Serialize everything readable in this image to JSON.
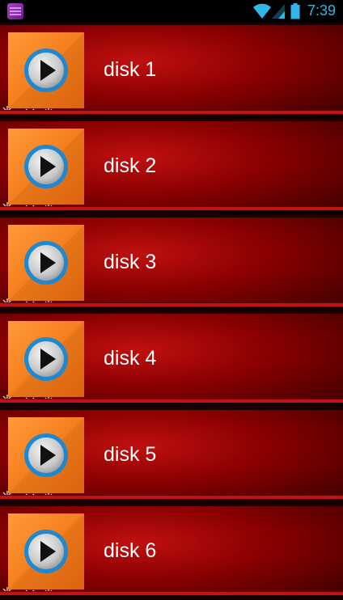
{
  "status_bar": {
    "time": "7:39",
    "icons": [
      "app-icon",
      "wifi-icon",
      "signal-icon",
      "battery-icon"
    ]
  },
  "colors": {
    "status_accent": "#33b5e5",
    "row_red": "#8a0000",
    "thumb_orange": "#f47c1a",
    "play_ring": "#1e88d0"
  },
  "items": [
    {
      "label": "disk 1"
    },
    {
      "label": "disk 2"
    },
    {
      "label": "disk 3"
    },
    {
      "label": "disk 4"
    },
    {
      "label": "disk 5"
    },
    {
      "label": "disk 6"
    }
  ]
}
